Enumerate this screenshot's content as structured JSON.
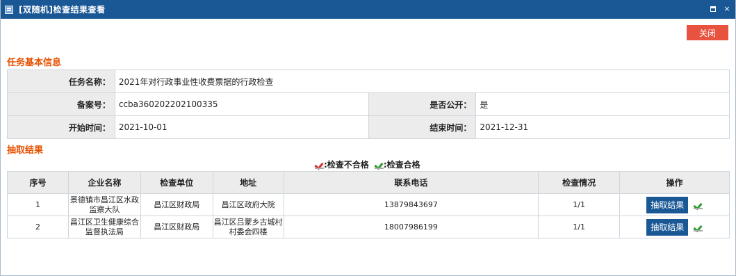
{
  "window": {
    "title": "[双随机]检查结果查看",
    "icons": [
      "app-icon",
      "maximize-icon",
      "close-icon"
    ],
    "close_glyph": "×"
  },
  "toolbar": {
    "close_label": "关闭",
    "close_color": "#e8533f"
  },
  "basic_info": {
    "section_title": "任务基本信息",
    "task_name_label": "任务名称：",
    "task_name": "2021年对行政事业性收费票据的行政检查",
    "record_no_label": "备案号：",
    "record_no": "ccba360202202100335",
    "public_label": "是否公开：",
    "public_value": "是",
    "start_label": "开始时间：",
    "start_value": "2021-10-01",
    "end_label": "结束时间：",
    "end_value": "2021-12-31"
  },
  "results": {
    "section_title": "抽取结果",
    "legend": {
      "fail": ":检查不合格",
      "pass": ":检查合格"
    },
    "columns": [
      "序号",
      "企业名称",
      "检查单位",
      "地址",
      "联系电话",
      "检查情况",
      "操作"
    ],
    "rows": [
      {
        "no": "1",
        "company": "景德镇市昌江区水政监察大队",
        "unit": "昌江区财政局",
        "address": "昌江区政府大院",
        "phone": "13879843697",
        "status": "1/1",
        "button": "抽取结果",
        "result": "pass"
      },
      {
        "no": "2",
        "company": "昌江区卫生健康综合监督执法局",
        "unit": "昌江区财政局",
        "address": "昌江区吕蒙乡古城村村委会四楼",
        "phone": "18007986199",
        "status": "1/1",
        "button": "抽取结果",
        "result": "pass"
      }
    ]
  },
  "colors": {
    "titlebar": "#1a5895",
    "accent": "#e65100",
    "pass": "#2e9b2e",
    "fail": "#d32f2f",
    "button": "#1a5895"
  }
}
